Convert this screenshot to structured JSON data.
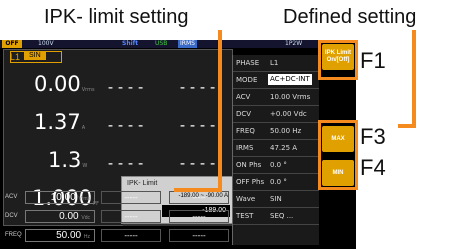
{
  "callouts": {
    "ipk_limit": "IPK- limit setting",
    "defined": "Defined setting",
    "f1": "F1",
    "f3": "F3",
    "f4": "F4"
  },
  "topbar": {
    "output": "OFF",
    "voltage": "100V",
    "shift": "Shift",
    "usb": "USB",
    "irms": "IRMS",
    "mode": "1P2W"
  },
  "left": {
    "phase": "L1",
    "waveform": "SIN",
    "readings": [
      {
        "value": "0.00",
        "unit": "Vrms"
      },
      {
        "value": "1.37",
        "unit": "A"
      },
      {
        "value": "1.3",
        "unit": "W"
      },
      {
        "value": "1.000",
        "unit": "PF"
      }
    ],
    "dashes": "----"
  },
  "popup": {
    "title": "IPK- Limit",
    "range": "-189.00 ~ -90.00 A",
    "value": "-189.00"
  },
  "bottom": [
    {
      "label": "ACV",
      "value": "10.00",
      "unit": "Vrms",
      "d1": "-----",
      "d2": "-----"
    },
    {
      "label": "DCV",
      "value": "0.00",
      "unit": "Vdc",
      "d1": "-----",
      "d2": "-----"
    },
    {
      "label": "FREQ",
      "value": "50.00",
      "unit": "Hz",
      "d1": "-----",
      "d2": "-----"
    }
  ],
  "params": [
    {
      "key": "PHASE",
      "value": "L1"
    },
    {
      "key": "MODE",
      "value": "AC+DC-INT"
    },
    {
      "key": "ACV",
      "value": "10.00 Vrms"
    },
    {
      "key": "DCV",
      "value": "+0.00 Vdc"
    },
    {
      "key": "FREQ",
      "value": "50.00 Hz"
    },
    {
      "key": "IRMS",
      "value": "47.25 A"
    },
    {
      "key": "ON Phs",
      "value": "0.0 °"
    },
    {
      "key": "OFF Phs",
      "value": "0.0 °"
    },
    {
      "key": "Wave",
      "value": "SIN"
    },
    {
      "key": "TEST",
      "value": "SEQ ..."
    }
  ],
  "softkeys": {
    "f1": "IPK Limit On/[Off]",
    "f3": "MAX",
    "f4": "MIN"
  },
  "colors": {
    "accent": "#f58a1f",
    "softkey": "#e0a000"
  }
}
